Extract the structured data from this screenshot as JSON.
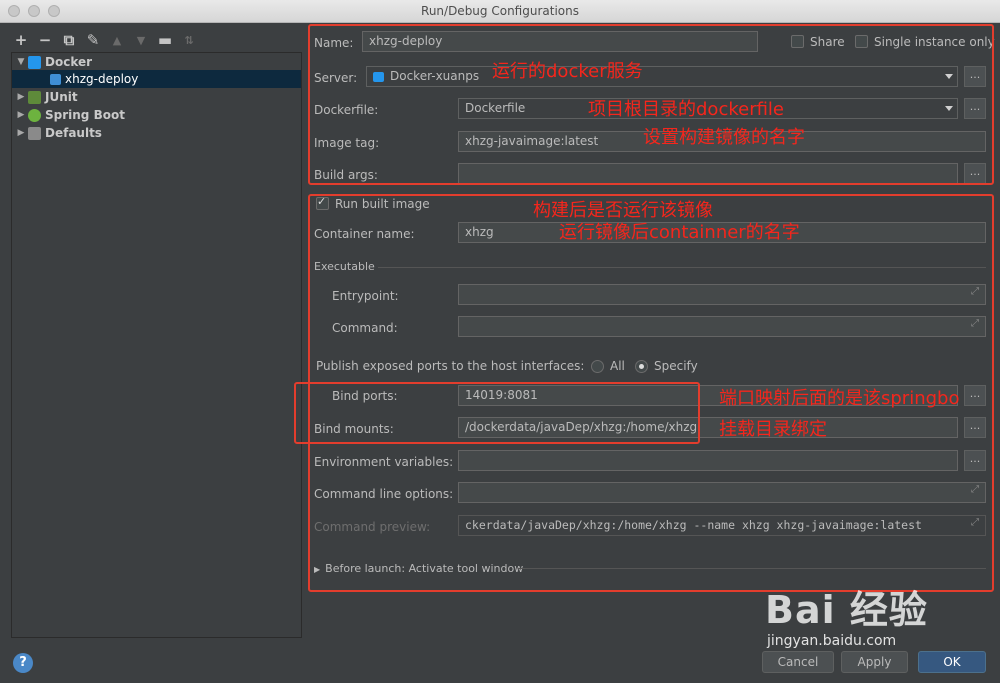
{
  "window": {
    "title": "Run/Debug Configurations"
  },
  "tree": {
    "items": [
      {
        "label": "Docker"
      },
      {
        "label": "xhzg-deploy"
      },
      {
        "label": "JUnit"
      },
      {
        "label": "Spring Boot"
      },
      {
        "label": "Defaults"
      }
    ]
  },
  "form": {
    "name_label": "Name:",
    "name_value": "xhzg-deploy",
    "share_label": "Share",
    "single_instance_label": "Single instance only",
    "server_label": "Server:",
    "server_value": "Docker-xuanps",
    "dockerfile_label": "Dockerfile:",
    "dockerfile_value": "Dockerfile",
    "image_tag_label": "Image tag:",
    "image_tag_value": "xhzg-javaimage:latest",
    "build_args_label": "Build args:",
    "run_built_image_label": "Run built image",
    "container_name_label": "Container name:",
    "container_name_value": "xhzg",
    "executable_label": "Executable",
    "entrypoint_label": "Entrypoint:",
    "command_label": "Command:",
    "publish_label": "Publish exposed ports to the host interfaces:",
    "all_label": "All",
    "specify_label": "Specify",
    "bind_ports_label": "Bind ports:",
    "bind_ports_value": "14019:8081",
    "bind_mounts_label": "Bind mounts:",
    "bind_mounts_value": "/dockerdata/javaDep/xhzg:/home/xhzg",
    "env_vars_label": "Environment variables:",
    "cmd_options_label": "Command line options:",
    "cmd_preview_label": "Command preview:",
    "cmd_preview_value": "ckerdata/javaDep/xhzg:/home/xhzg --name xhzg xhzg-javaimage:latest",
    "before_launch_label": "Before launch: Activate tool window",
    "ellipsis": "..."
  },
  "annotations": {
    "a1": "运行的docker服务",
    "a2": "项目根目录的dockerfile",
    "a3": "设置构建镜像的名字",
    "a4": "构建后是否运行该镜像",
    "a5": "运行镜像后containner的名字",
    "a6": "端口映射后面的是该springbo",
    "a7": "挂载目录绑定"
  },
  "buttons": {
    "cancel": "Cancel",
    "apply": "Apply",
    "ok": "OK",
    "help": "?"
  },
  "watermark": {
    "brand": "Bai 经验",
    "url": "jingyan.baidu.com"
  },
  "colors": {
    "annotation": "#f5261c",
    "selection": "#0d293e",
    "primary_button": "#365880"
  }
}
